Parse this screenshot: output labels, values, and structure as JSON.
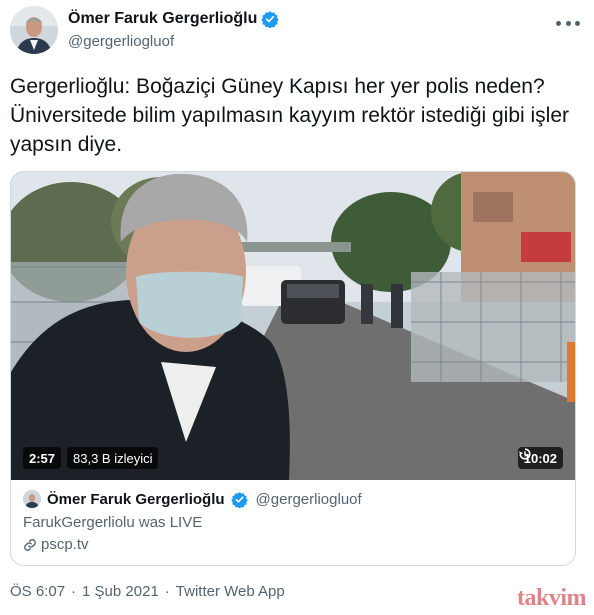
{
  "author": {
    "name": "Ömer Faruk Gergerlioğlu",
    "handle": "@gergerliogluof",
    "verified_icon": "verified-badge-icon",
    "more_icon": "more-options-icon"
  },
  "tweet": {
    "text": "Gergerlioğlu: Boğaziçi Güney Kapısı her yer polis neden? Üniversitede bilim yapılmasın kayyım rektör istediği gibi işler yapsın diye."
  },
  "video": {
    "elapsed": "2:57",
    "views": "83,3 B izleyici",
    "duration": "10:02",
    "replay_icon": "replay-icon"
  },
  "card": {
    "name": "Ömer Faruk Gergerlioğlu",
    "handle": "@gergerliogluof",
    "description": "FarukGergerliolu was LIVE",
    "link": "pscp.tv",
    "link_icon": "link-icon"
  },
  "footer": {
    "time": "ÖS 6:07",
    "sep1": "·",
    "date": "1 Şub 2021",
    "sep2": "·",
    "source": "Twitter Web App"
  },
  "watermark": "takvim",
  "colors": {
    "verified": "#1d9bf0",
    "text_primary": "#0f1419",
    "text_secondary": "#536471",
    "border": "#cfd9de"
  }
}
